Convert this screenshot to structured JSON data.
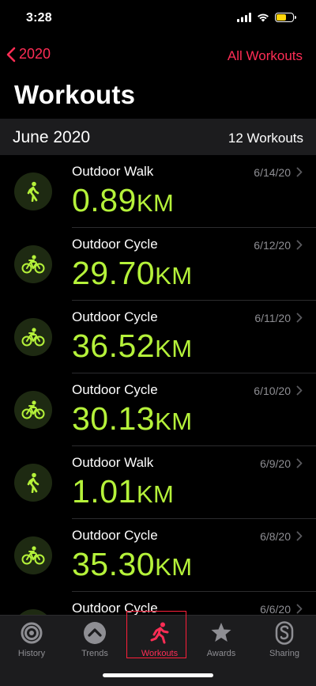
{
  "status_bar": {
    "time": "3:28"
  },
  "nav": {
    "back_label": "2020",
    "right_label": "All Workouts"
  },
  "page_title": "Workouts",
  "section": {
    "label": "June 2020",
    "count": "12 Workouts"
  },
  "workouts": [
    {
      "type": "walk",
      "name": "Outdoor Walk",
      "value": "0.89",
      "unit": "KM",
      "date": "6/14/20"
    },
    {
      "type": "cycle",
      "name": "Outdoor Cycle",
      "value": "29.70",
      "unit": "KM",
      "date": "6/12/20"
    },
    {
      "type": "cycle",
      "name": "Outdoor Cycle",
      "value": "36.52",
      "unit": "KM",
      "date": "6/11/20"
    },
    {
      "type": "cycle",
      "name": "Outdoor Cycle",
      "value": "30.13",
      "unit": "KM",
      "date": "6/10/20"
    },
    {
      "type": "walk",
      "name": "Outdoor Walk",
      "value": "1.01",
      "unit": "KM",
      "date": "6/9/20"
    },
    {
      "type": "cycle",
      "name": "Outdoor Cycle",
      "value": "35.30",
      "unit": "KM",
      "date": "6/8/20"
    },
    {
      "type": "cycle",
      "name": "Outdoor Cycle",
      "value": "",
      "unit": "",
      "date": "6/6/20"
    }
  ],
  "tabs": [
    {
      "label": "History",
      "icon": "history-rings-icon"
    },
    {
      "label": "Trends",
      "icon": "trends-chevron-icon"
    },
    {
      "label": "Workouts",
      "icon": "running-figure-icon",
      "active": true
    },
    {
      "label": "Awards",
      "icon": "award-star-icon"
    },
    {
      "label": "Sharing",
      "icon": "sharing-s-icon"
    }
  ],
  "colors": {
    "accent": "#ff2d55",
    "metric": "#b5f23a",
    "background": "#000000"
  }
}
